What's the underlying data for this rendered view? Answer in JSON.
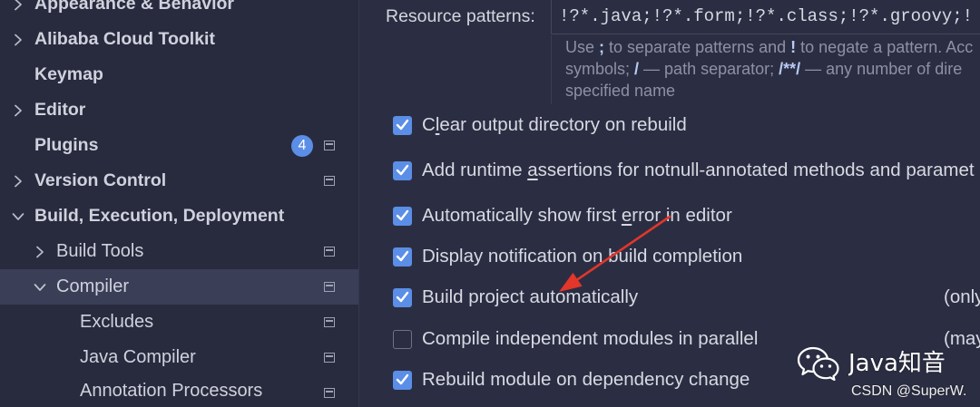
{
  "theme": {
    "accent": "#5b8ee6",
    "selection": "#3a3e57",
    "annotation": "#e2362b"
  },
  "sidebar": {
    "items": [
      {
        "label": "Appearance & Behavior",
        "level": 0,
        "expandable": true,
        "expanded": false
      },
      {
        "label": "Alibaba Cloud Toolkit",
        "level": 0,
        "expandable": true,
        "expanded": false
      },
      {
        "label": "Keymap",
        "level": 0,
        "expandable": false
      },
      {
        "label": "Editor",
        "level": 0,
        "expandable": true,
        "expanded": false
      },
      {
        "label": "Plugins",
        "level": 0,
        "expandable": false,
        "badge": "4",
        "icon": "project-settings-icon"
      },
      {
        "label": "Version Control",
        "level": 0,
        "expandable": true,
        "expanded": false,
        "icon": "project-settings-icon"
      },
      {
        "label": "Build, Execution, Deployment",
        "level": 0,
        "expandable": true,
        "expanded": true
      },
      {
        "label": "Build Tools",
        "level": 1,
        "expandable": true,
        "expanded": false,
        "icon": "project-settings-icon"
      },
      {
        "label": "Compiler",
        "level": 1,
        "expandable": true,
        "expanded": true,
        "selected": true,
        "icon": "project-settings-icon"
      },
      {
        "label": "Excludes",
        "level": 2,
        "expandable": false,
        "icon": "project-settings-icon"
      },
      {
        "label": "Java Compiler",
        "level": 2,
        "expandable": false,
        "icon": "project-settings-icon"
      },
      {
        "label": "Annotation Processors",
        "level": 2,
        "expandable": false,
        "icon": "project-settings-icon"
      }
    ]
  },
  "compiler": {
    "resource_patterns": {
      "label": "Resource patterns:",
      "value": "!?*.java;!?*.form;!?*.class;!?*.groovy;!"
    },
    "help": {
      "lines": [
        [
          {
            "text": "Use "
          },
          {
            "text": ";",
            "emphasis": true
          },
          {
            "text": " to separate patterns and "
          },
          {
            "text": "!",
            "emphasis": true
          },
          {
            "text": " to negate a pattern. Acc"
          }
        ],
        [
          {
            "text": "symbols; "
          },
          {
            "text": "/",
            "emphasis": true
          },
          {
            "text": " — path separator; "
          },
          {
            "text": "/**/",
            "emphasis": true
          },
          {
            "text": " — any number of dire"
          }
        ],
        [
          {
            "text": "specified name"
          }
        ]
      ]
    },
    "options": [
      {
        "label": "Clear output directory on rebuild",
        "mnemonic": "l",
        "checked": true
      },
      {
        "label": "Add runtime assertions for notnull-annotated methods and paramet",
        "mnemonic": "a",
        "checked": true
      },
      {
        "label": "Automatically show first error in editor",
        "mnemonic": "e",
        "checked": true
      },
      {
        "label": "Display notification on build completion",
        "checked": true
      },
      {
        "label": "Build project automatically",
        "checked": true,
        "note": "(only"
      },
      {
        "label": "Compile independent modules in parallel",
        "checked": false,
        "note": "(may"
      },
      {
        "label": "Rebuild module on dependency change",
        "checked": true
      }
    ]
  },
  "watermark": {
    "icon": "wechat-icon",
    "title": "Java知音",
    "credit": "CSDN @SuperW."
  }
}
